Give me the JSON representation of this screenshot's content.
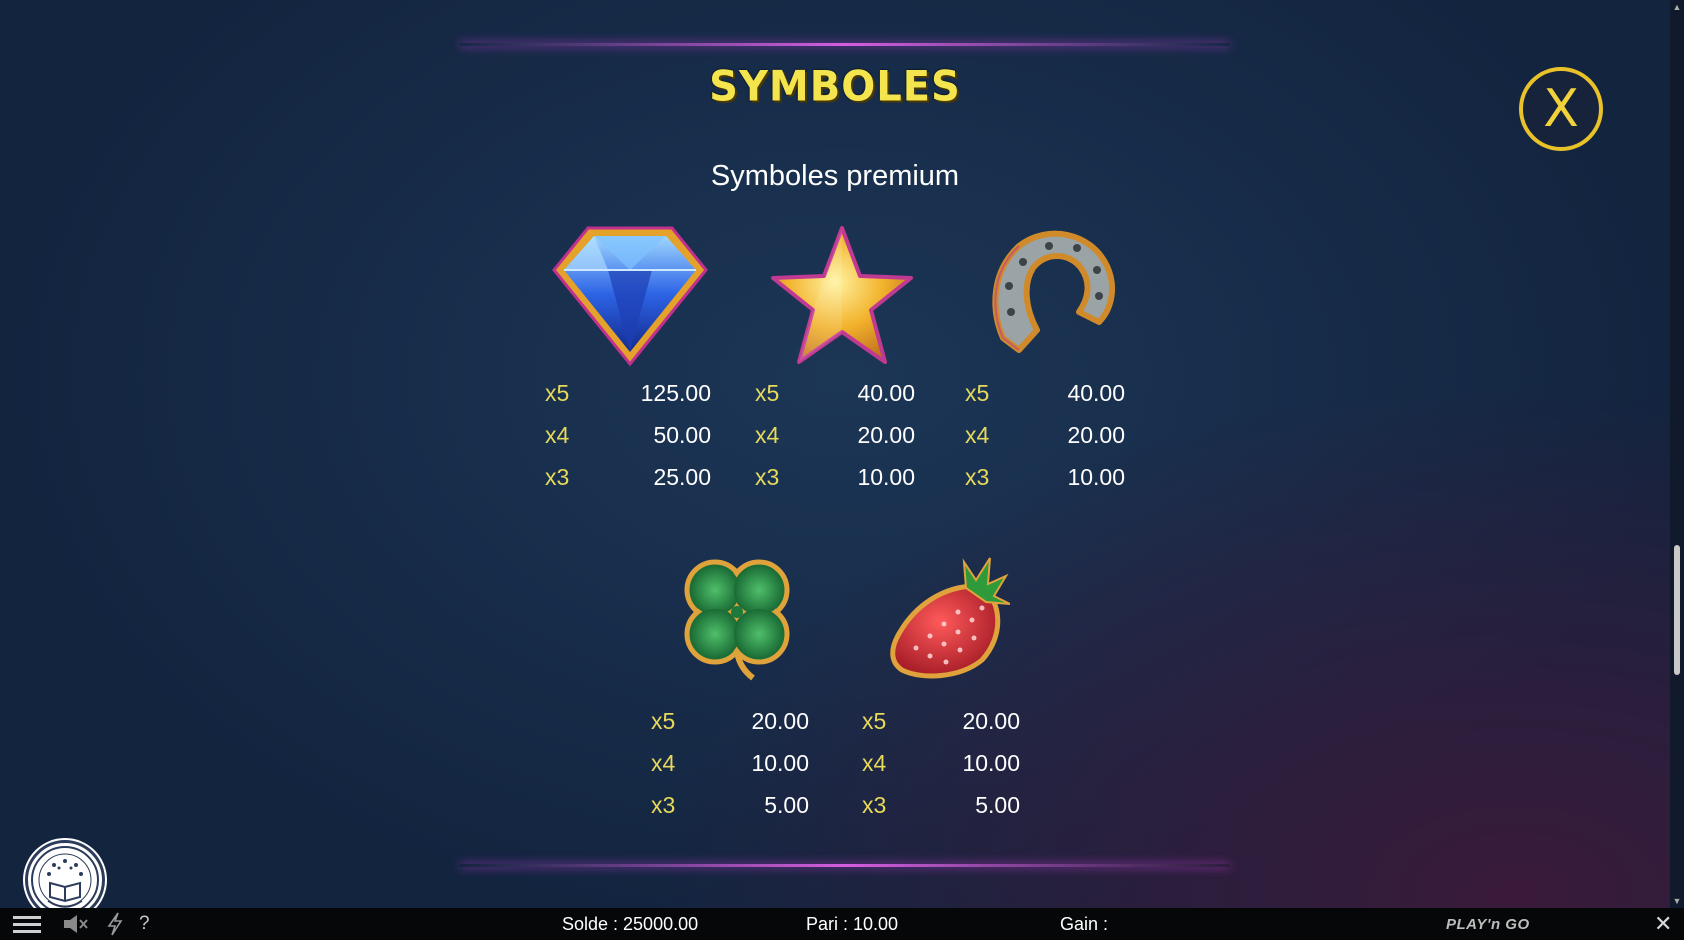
{
  "paytable": {
    "title": "SYMBOLES",
    "subtitle": "Symboles premium",
    "close_label": "X",
    "symbols": [
      {
        "icon": "diamond-icon",
        "pays": [
          {
            "mult": "x5",
            "value": "125.00"
          },
          {
            "mult": "x4",
            "value": "50.00"
          },
          {
            "mult": "x3",
            "value": "25.00"
          }
        ]
      },
      {
        "icon": "star-icon",
        "pays": [
          {
            "mult": "x5",
            "value": "40.00"
          },
          {
            "mult": "x4",
            "value": "20.00"
          },
          {
            "mult": "x3",
            "value": "10.00"
          }
        ]
      },
      {
        "icon": "horseshoe-icon",
        "pays": [
          {
            "mult": "x5",
            "value": "40.00"
          },
          {
            "mult": "x4",
            "value": "20.00"
          },
          {
            "mult": "x3",
            "value": "10.00"
          }
        ]
      },
      {
        "icon": "clover-icon",
        "pays": [
          {
            "mult": "x5",
            "value": "20.00"
          },
          {
            "mult": "x4",
            "value": "10.00"
          },
          {
            "mult": "x3",
            "value": "5.00"
          }
        ]
      },
      {
        "icon": "strawberry-icon",
        "pays": [
          {
            "mult": "x5",
            "value": "20.00"
          },
          {
            "mult": "x4",
            "value": "10.00"
          },
          {
            "mult": "x3",
            "value": "5.00"
          }
        ]
      }
    ]
  },
  "bottom_bar": {
    "balance": "Solde : 25000.00",
    "bet": "Pari : 10.00",
    "win": "Gain :",
    "help": "?",
    "brand": "PLAY'n GO",
    "close": "✕"
  },
  "badge": {
    "label": "BOOK OF BONUS"
  },
  "colors": {
    "title": "#f4e44e",
    "multiplier": "#e7d95a",
    "accent_line": "#d45ee0",
    "close_ring": "#e9c22a",
    "background": "#13243f"
  }
}
